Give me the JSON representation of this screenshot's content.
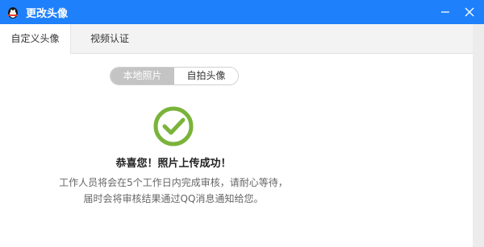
{
  "window": {
    "title": "更改头像",
    "icons": {
      "app": "qq-penguin-icon",
      "minimize": "minimize-icon",
      "close": "close-icon"
    }
  },
  "tabs": [
    {
      "label": "自定义头像",
      "active": true
    },
    {
      "label": "视频认证",
      "active": false
    }
  ],
  "segmented": {
    "options": [
      "本地照片",
      "自拍头像"
    ],
    "selected": "本地照片"
  },
  "result": {
    "icon": "check-circle-icon",
    "icon_color": "#7ab33a",
    "title": "恭喜您！照片上传成功！",
    "desc_line1": "工作人员将会在5个工作日内完成审核，请耐心等待，",
    "desc_line2": "届时会将审核结果通过QQ消息通知给您。"
  },
  "colors": {
    "titlebar": "#1e80fb",
    "segment_selected": "#c4c4c4"
  }
}
